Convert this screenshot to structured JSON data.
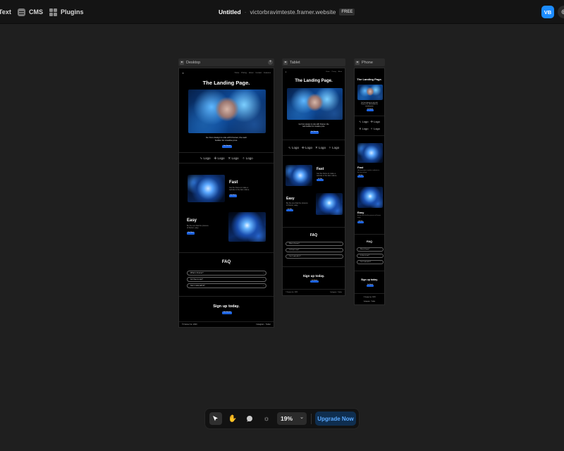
{
  "topbar": {
    "menu": [
      {
        "label": "Text",
        "icon": "text-icon"
      },
      {
        "label": "CMS",
        "icon": "cms-icon"
      },
      {
        "label": "Plugins",
        "icon": "plugins-icon"
      }
    ],
    "project_title": "Untitled",
    "separator": "·",
    "domain": "victorbravimteste.framer.website",
    "plan_badge": "FREE",
    "avatar_initials": "VB",
    "avatar_color": "#1c8cff"
  },
  "frames": {
    "desktop": {
      "label": "Desktop"
    },
    "tablet": {
      "label": "Tablet"
    },
    "phone": {
      "label": "Phone"
    }
  },
  "site": {
    "hero_title": "The Landing Page.",
    "hero_subtitle": "Go from design to site with Framer, the web builder for creative pros.",
    "hero_button": "Get Started",
    "logo_label": "Logo",
    "logos": [
      "Logo",
      "Logo",
      "Logo",
      "Logo"
    ],
    "feature_fast_title": "Fast",
    "feature_fast_text": "Get the frame to make a website in the fast culture.",
    "feature_easy_title": "Easy",
    "feature_easy_text": "Be the one that the process of framer, easy.",
    "feature_button": "Get Start",
    "faq_title": "FAQ",
    "faq_items": [
      "What is Framer?",
      "Is it free to use?",
      "Can I code with it?"
    ],
    "signup_title": "Sign up today.",
    "signup_button": "Get Started",
    "footer_left": "© Framer Inc. 2023",
    "footer_right": "Instagram · Twitter",
    "nav_links": [
      "Home",
      "Pricing",
      "About",
      "Contact",
      "Features"
    ]
  },
  "toolbar": {
    "tools": [
      {
        "name": "select-tool",
        "icon": "cursor-icon",
        "active": true
      },
      {
        "name": "hand-tool",
        "icon": "hand-icon",
        "active": false
      },
      {
        "name": "comment-tool",
        "icon": "comment-icon",
        "active": false
      },
      {
        "name": "theme-tool",
        "icon": "sun-icon",
        "active": false
      }
    ],
    "zoom": "19%",
    "upgrade_label": "Upgrade Now",
    "accent": "#5aa9ff"
  }
}
